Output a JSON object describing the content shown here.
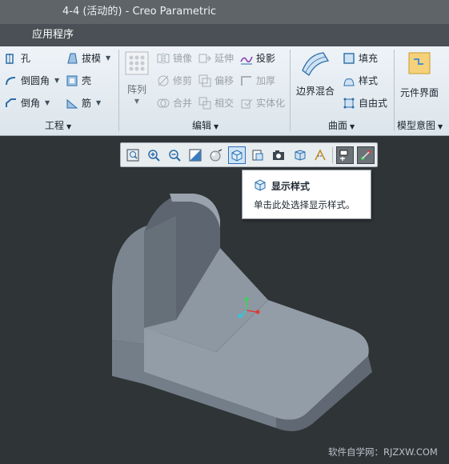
{
  "window": {
    "title": "4-4 (活动的) - Creo Parametric"
  },
  "menu": {
    "active_tab": "应用程序"
  },
  "ribbon": {
    "engineering": {
      "hole": "孔",
      "round": "倒圆角",
      "chamfer": "倒角",
      "draft": "拔模",
      "shell": "壳",
      "rib": "筋",
      "group_label": "工程"
    },
    "editing": {
      "pattern": "阵列",
      "mirror": "镜像",
      "trim": "修剪",
      "merge": "合并",
      "extend": "延伸",
      "offset": "偏移",
      "intersect": "相交",
      "project": "投影",
      "thicken": "加厚",
      "solidify": "实体化",
      "group_label": "编辑"
    },
    "surfaces": {
      "boundary_blend": "边界混合",
      "fill": "填充",
      "style": "样式",
      "freestyle": "自由式",
      "group_label": "曲面"
    },
    "model_intent": {
      "component_interface": "元件界面",
      "group_label": "模型意图"
    }
  },
  "view_toolbar": {
    "icons": [
      "refit-icon",
      "zoom-in-icon",
      "zoom-out-icon",
      "repaint-icon",
      "appearance-icon",
      "display-style-icon",
      "saved-orientations-icon",
      "view-manager-icon",
      "perspective-icon",
      "annotation-display-icon",
      "datum-display-icon",
      "spin-center-icon"
    ],
    "active": "display-style-icon"
  },
  "tooltip": {
    "title": "显示样式",
    "description": "单击此处选择显示样式。"
  },
  "watermark": "软件自学网：RJZXW.COM",
  "colors": {
    "viewport_bg": "#2f3437",
    "ribbon_bg": "#e3eaf0",
    "model_face_top": "#8d96a0",
    "model_face_side": "#5e6670",
    "accent": "#2e6fb8"
  }
}
